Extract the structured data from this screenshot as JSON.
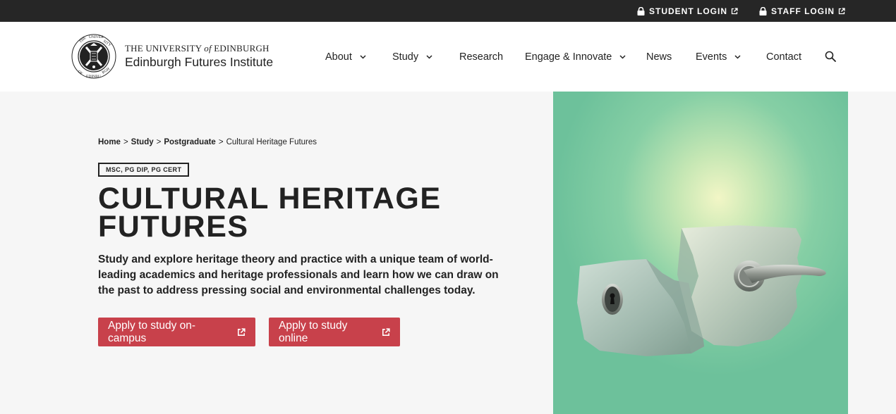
{
  "topbar": {
    "student_login": "STUDENT LOGIN",
    "staff_login": "STAFF LOGIN"
  },
  "header": {
    "logo_line1_a": "THE UNIVERSITY",
    "logo_line1_of": "of",
    "logo_line1_b": "EDINBURGH",
    "logo_line2": "Edinburgh Futures Institute",
    "nav": [
      {
        "label": "About",
        "has_dropdown": true
      },
      {
        "label": "Study",
        "has_dropdown": true
      },
      {
        "label": "Research",
        "has_dropdown": false
      },
      {
        "label": "Engage & Innovate",
        "has_dropdown": true
      },
      {
        "label": "News",
        "has_dropdown": false
      },
      {
        "label": "Events",
        "has_dropdown": true
      },
      {
        "label": "Contact",
        "has_dropdown": false
      }
    ],
    "search_icon": "search-icon"
  },
  "breadcrumb": {
    "items": [
      "Home",
      "Study",
      "Postgraduate"
    ],
    "separator": ">",
    "current": "Cultural Heritage Futures"
  },
  "hero": {
    "badge": "MSC, PG DIP, PG CERT",
    "title": "CULTURAL HERITAGE FUTURES",
    "lede": "Study and explore heritage theory and practice with a unique team of world-leading academics and heritage professionals and learn how we can draw on the past to address pressing social and environmental challenges today.",
    "buttons": [
      {
        "label": "Apply to study on-campus",
        "icon": "external-link-icon"
      },
      {
        "label": "Apply to study online",
        "icon": "external-link-icon"
      }
    ]
  },
  "colors": {
    "topbar": "#262626",
    "accent": "#c8414b",
    "background": "#f6f6f6",
    "image_green": "#6cc29c"
  }
}
